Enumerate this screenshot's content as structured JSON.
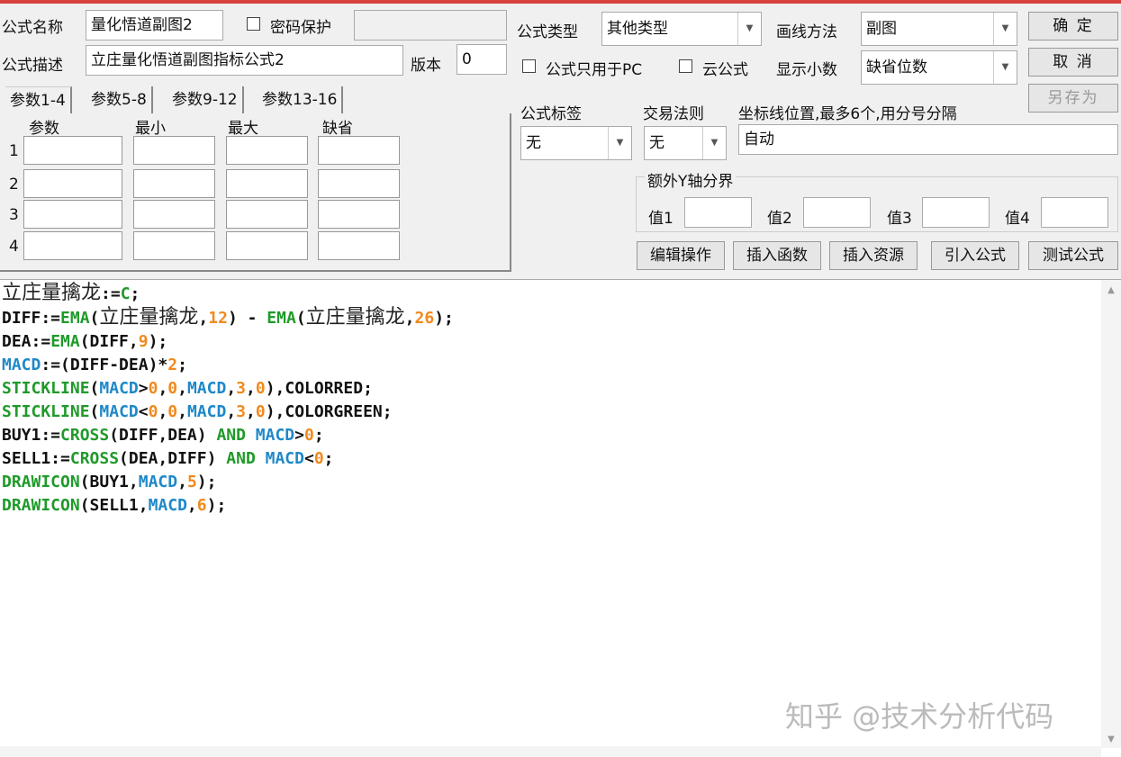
{
  "form": {
    "name_label": "公式名称",
    "name_value": "量化悟道副图2",
    "password_label": "密码保护",
    "password_value": "",
    "desc_label": "公式描述",
    "desc_value": "立庄量化悟道副图指标公式2",
    "version_label": "版本",
    "version_value": "0"
  },
  "options": {
    "type_label": "公式类型",
    "type_value": "其他类型",
    "draw_label": "画线方法",
    "draw_value": "副图",
    "pc_only_label": "公式只用于PC",
    "cloud_label": "云公式",
    "decimal_label": "显示小数",
    "decimal_value": "缺省位数",
    "tag_label": "公式标签",
    "tag_value": "无",
    "rule_label": "交易法则",
    "rule_value": "无",
    "axis_label": "坐标线位置,最多6个,用分号分隔",
    "axis_value": "自动",
    "yaxis_group": "额外Y轴分界",
    "v1": "值1",
    "v2": "值2",
    "v3": "值3",
    "v4": "值4"
  },
  "buttons": {
    "ok": "确 定",
    "cancel": "取 消",
    "save_as": "另存为",
    "edit_ops": "编辑操作",
    "insert_func": "插入函数",
    "insert_res": "插入资源",
    "import": "引入公式",
    "test": "测试公式"
  },
  "tabs": [
    "参数1-4",
    "参数5-8",
    "参数9-12",
    "参数13-16"
  ],
  "params": {
    "headers": [
      "参数",
      "最小",
      "最大",
      "缺省"
    ],
    "rows": [
      "1",
      "2",
      "3",
      "4"
    ]
  },
  "code": [
    [
      [
        "立庄量擒龙",
        "c"
      ],
      [
        ":=",
        "d"
      ],
      [
        "C",
        "f"
      ],
      [
        ";",
        "d"
      ]
    ],
    [
      [
        "DIFF:=",
        "d"
      ],
      [
        "EMA",
        "f"
      ],
      [
        "(",
        "d"
      ],
      [
        "立庄量擒龙",
        "c"
      ],
      [
        ",",
        "d"
      ],
      [
        "12",
        "n"
      ],
      [
        ") - ",
        "d"
      ],
      [
        "EMA",
        "f"
      ],
      [
        "(",
        "d"
      ],
      [
        "立庄量擒龙",
        "c"
      ],
      [
        ",",
        "d"
      ],
      [
        "26",
        "n"
      ],
      [
        ");",
        "d"
      ]
    ],
    [
      [
        "DEA:=",
        "d"
      ],
      [
        "EMA",
        "f"
      ],
      [
        "(DIFF,",
        "d"
      ],
      [
        "9",
        "n"
      ],
      [
        ");",
        "d"
      ]
    ],
    [
      [
        "MACD",
        "v"
      ],
      [
        ":=(DIFF-DEA)*",
        "d"
      ],
      [
        "2",
        "n"
      ],
      [
        ";",
        "d"
      ]
    ],
    [
      [
        "STICKLINE",
        "f"
      ],
      [
        "(",
        "d"
      ],
      [
        "MACD",
        "v"
      ],
      [
        ">",
        "d"
      ],
      [
        "0",
        "n"
      ],
      [
        ",",
        "d"
      ],
      [
        "0",
        "n"
      ],
      [
        ",",
        "d"
      ],
      [
        "MACD",
        "v"
      ],
      [
        ",",
        "d"
      ],
      [
        "3",
        "n"
      ],
      [
        ",",
        "d"
      ],
      [
        "0",
        "n"
      ],
      [
        "),COLORRED;",
        "d"
      ]
    ],
    [
      [
        "STICKLINE",
        "f"
      ],
      [
        "(",
        "d"
      ],
      [
        "MACD",
        "v"
      ],
      [
        "<",
        "d"
      ],
      [
        "0",
        "n"
      ],
      [
        ",",
        "d"
      ],
      [
        "0",
        "n"
      ],
      [
        ",",
        "d"
      ],
      [
        "MACD",
        "v"
      ],
      [
        ",",
        "d"
      ],
      [
        "3",
        "n"
      ],
      [
        ",",
        "d"
      ],
      [
        "0",
        "n"
      ],
      [
        "),COLORGREEN;",
        "d"
      ]
    ],
    [
      [
        "BUY1:=",
        "d"
      ],
      [
        "CROSS",
        "f"
      ],
      [
        "(DIFF,DEA) ",
        "d"
      ],
      [
        "AND",
        "f"
      ],
      [
        " ",
        "d"
      ],
      [
        "MACD",
        "v"
      ],
      [
        ">",
        "d"
      ],
      [
        "0",
        "n"
      ],
      [
        ";",
        "d"
      ]
    ],
    [
      [
        "SELL1:=",
        "d"
      ],
      [
        "CROSS",
        "f"
      ],
      [
        "(DEA,DIFF) ",
        "d"
      ],
      [
        "AND",
        "f"
      ],
      [
        " ",
        "d"
      ],
      [
        "MACD",
        "v"
      ],
      [
        "<",
        "d"
      ],
      [
        "0",
        "n"
      ],
      [
        ";",
        "d"
      ]
    ],
    [
      [
        "DRAWICON",
        "f"
      ],
      [
        "(BUY1,",
        "d"
      ],
      [
        "MACD",
        "v"
      ],
      [
        ",",
        "d"
      ],
      [
        "5",
        "n"
      ],
      [
        ");",
        "d"
      ]
    ],
    [
      [
        "DRAWICON",
        "f"
      ],
      [
        "(SELL1,",
        "d"
      ],
      [
        "MACD",
        "v"
      ],
      [
        ",",
        "d"
      ],
      [
        "6",
        "n"
      ],
      [
        ");",
        "d"
      ]
    ]
  ],
  "watermark": "知乎 @技术分析代码"
}
